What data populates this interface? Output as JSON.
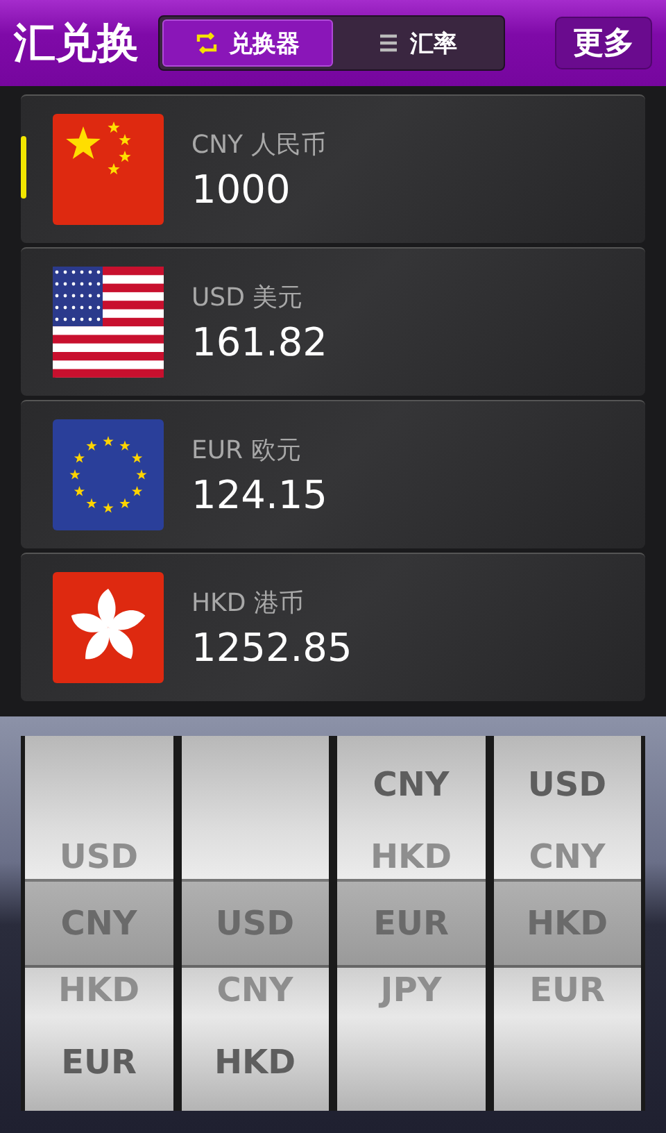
{
  "app_title": "汇兑换",
  "tabs": [
    {
      "label": "兑换器",
      "kind": "swap",
      "selected": true
    },
    {
      "label": "汇率",
      "kind": "list",
      "selected": false
    }
  ],
  "more_button": "更多",
  "currencies": [
    {
      "kind": "cn",
      "name": "CNY 人民币",
      "amount": "1000",
      "selected": true
    },
    {
      "kind": "us",
      "name": "USD 美元",
      "amount": "161.82",
      "selected": false
    },
    {
      "kind": "eu",
      "name": "EUR 欧元",
      "amount": "124.15",
      "selected": false
    },
    {
      "kind": "hk",
      "name": "HKD 港币",
      "amount": "1252.85",
      "selected": false
    }
  ],
  "picker": [
    {
      "above": [
        "USD"
      ],
      "current": "CNY",
      "below": [
        "HKD",
        "EUR"
      ]
    },
    {
      "current": "USD",
      "below": [
        "CNY",
        "HKD"
      ]
    },
    {
      "above": [
        "CNY",
        "HKD"
      ],
      "current": "EUR",
      "below": [
        "JPY"
      ]
    },
    {
      "above": [
        "USD",
        "CNY"
      ],
      "current": "HKD",
      "below": [
        "EUR"
      ]
    }
  ]
}
